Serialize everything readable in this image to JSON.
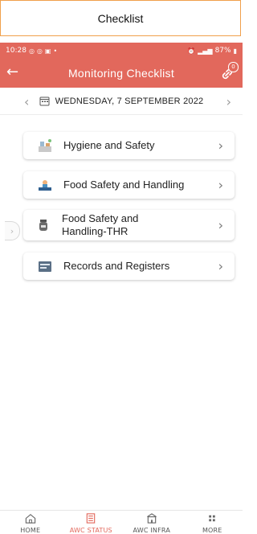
{
  "caption": "Checklist",
  "status_bar": {
    "time": "10:28",
    "battery": "87%"
  },
  "header": {
    "title": "Monitoring Checklist",
    "badge": "0",
    "back_icon": "back-arrow-icon"
  },
  "date_bar": {
    "date": "WEDNESDAY, 7 SEPTEMBER 2022"
  },
  "checklist": [
    {
      "label": "Hygiene and Safety",
      "icon": "hygiene-icon"
    },
    {
      "label": "Food Safety and Handling",
      "icon": "food-handling-icon"
    },
    {
      "label": "Food Safety and Handling-THR",
      "icon": "thr-jar-icon"
    },
    {
      "label": "Records and Registers",
      "icon": "records-icon"
    }
  ],
  "bottom_nav": {
    "items": [
      {
        "label": "HOME",
        "icon": "home-icon"
      },
      {
        "label": "AWC STATUS",
        "icon": "awc-status-icon",
        "active": true
      },
      {
        "label": "AWC INFRA",
        "icon": "building-icon"
      },
      {
        "label": "MORE",
        "icon": "more-grid-icon"
      }
    ]
  },
  "colors": {
    "brand": "#e2685c",
    "accent_border": "#f0a04b"
  }
}
